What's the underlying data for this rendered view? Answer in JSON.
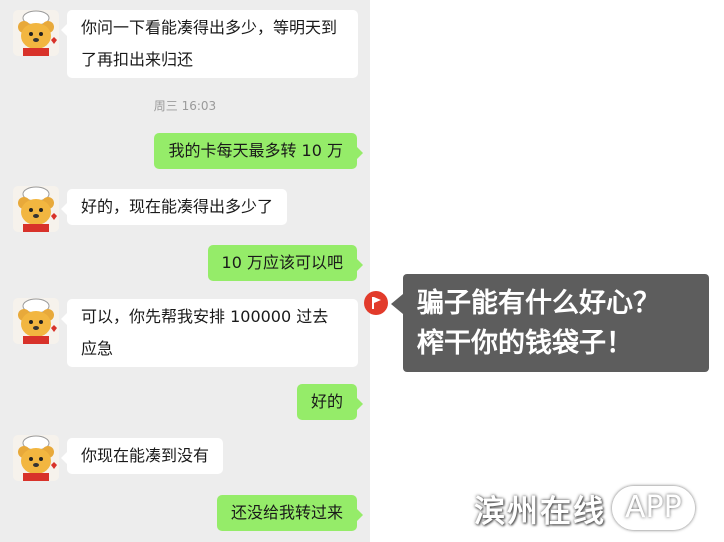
{
  "messages": [
    {
      "side": "in",
      "text": "你问一下看能凑得出多少，等明天到了再扣出来归还"
    },
    {
      "side": "out",
      "text": "我的卡每天最多转 10 万"
    },
    {
      "side": "in",
      "text": "好的，现在能凑得出多少了"
    },
    {
      "side": "out",
      "text": "10 万应该可以吧"
    },
    {
      "side": "in",
      "text": "可以，你先帮我安排 100000 过去应急"
    },
    {
      "side": "out",
      "text": "好的"
    },
    {
      "side": "in",
      "text": "你现在能凑到没有"
    },
    {
      "side": "out",
      "text": "还没给我转过来"
    }
  ],
  "timestamp": "周三 16:03",
  "annotation": {
    "line1": "骗子能有什么好心？",
    "line2": "榨干你的钱袋子！"
  },
  "watermark": {
    "name": "滨州在线",
    "app": "APP"
  },
  "colors": {
    "chat_bg": "#ededed",
    "incoming_bubble": "#ffffff",
    "outgoing_bubble": "#95ec69",
    "annotation_bg": "#5d5d5d",
    "annotation_icon": "#e23b2b"
  }
}
